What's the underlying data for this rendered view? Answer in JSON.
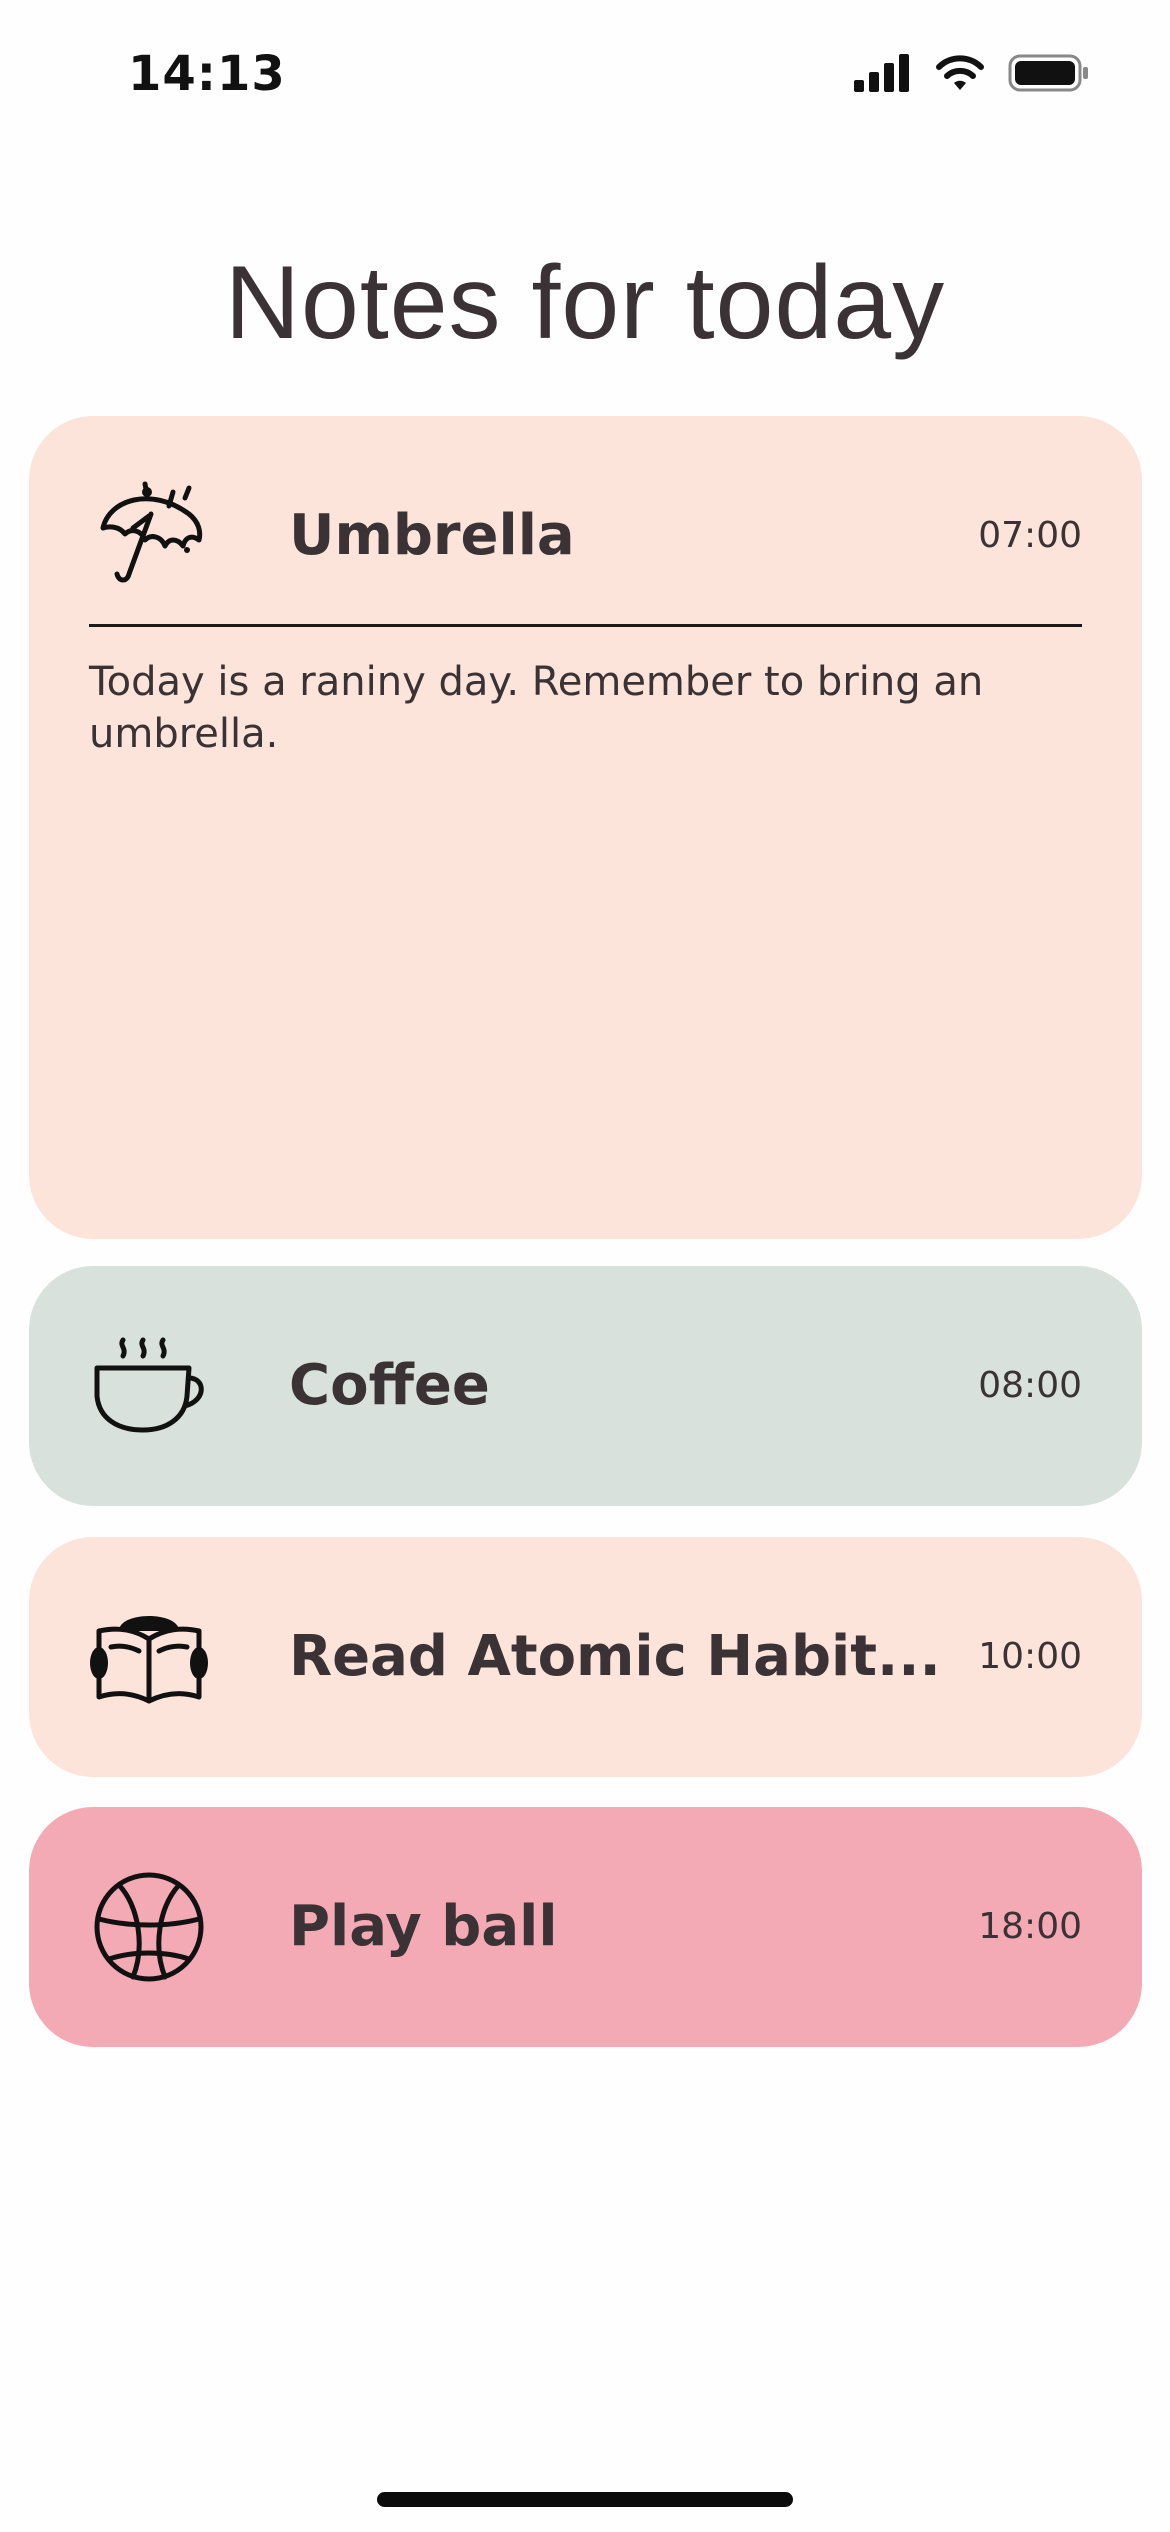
{
  "status_bar": {
    "time": "14:13",
    "icons": [
      "signal-icon",
      "wifi-icon",
      "battery-icon"
    ]
  },
  "page": {
    "title": "Notes for today"
  },
  "colors": {
    "peach": "#fde4da",
    "sage": "#d8e1dc",
    "pink": "#f3aab4",
    "text": "#3a3234"
  },
  "notes": [
    {
      "icon": "umbrella-icon",
      "title": "Umbrella",
      "time": "07:00",
      "body": "Today is a raniny day. Remember to bring an umbrella.",
      "expanded": true,
      "color": "#fde4da"
    },
    {
      "icon": "coffee-cup-icon",
      "title": "Coffee",
      "time": "08:00",
      "expanded": false,
      "color": "#d8e1dc"
    },
    {
      "icon": "reading-book-icon",
      "title": "Read Atomic Habit...",
      "time": "10:00",
      "expanded": false,
      "color": "#fde4da"
    },
    {
      "icon": "basketball-icon",
      "title": "Play ball",
      "time": "18:00",
      "expanded": false,
      "color": "#f3aab4"
    }
  ]
}
